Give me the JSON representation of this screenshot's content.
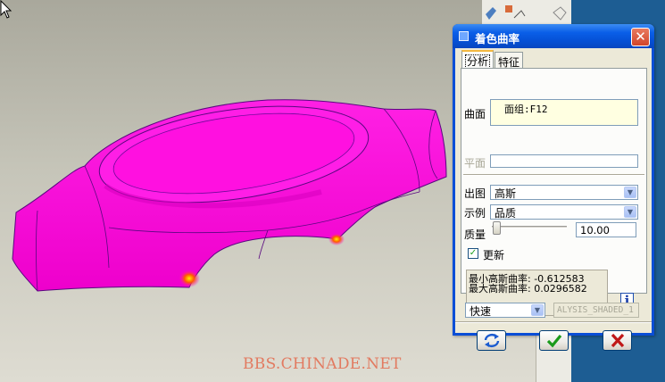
{
  "viewport": {
    "watermark": "BBS.CHINADE.NET",
    "model_color": "#ff00dd"
  },
  "dialog": {
    "title": "着色曲率",
    "close_glyph": "✕",
    "tabs": [
      {
        "label": "分析",
        "active": true
      },
      {
        "label": "特征",
        "active": false
      }
    ],
    "surface_label": "曲面",
    "surface_value": "面组:F12",
    "plane_label": "平面",
    "plane_value": "",
    "output_label": "出图",
    "output_value": "高斯",
    "example_label": "示例",
    "example_value": "品质",
    "quality_label": "质量",
    "quality_value": "10.00",
    "quality_slider_level": 0.0,
    "update_label": "更新",
    "update_checked": true,
    "result_min": "最小高斯曲率: -0.612583",
    "result_max": "最大高斯曲率: 0.0296582",
    "info_glyph": "i",
    "mode_value": "快速",
    "name_value": "ALYSIS_SHADED_1",
    "buttons": {
      "repeat_icon": "refresh-icon",
      "ok_icon": "check-icon",
      "cancel_icon": "cancel-x-icon"
    },
    "colors": {
      "titlebar": "#0550d5",
      "ok_check": "#1a9a1a",
      "cancel_x": "#c01818"
    }
  }
}
